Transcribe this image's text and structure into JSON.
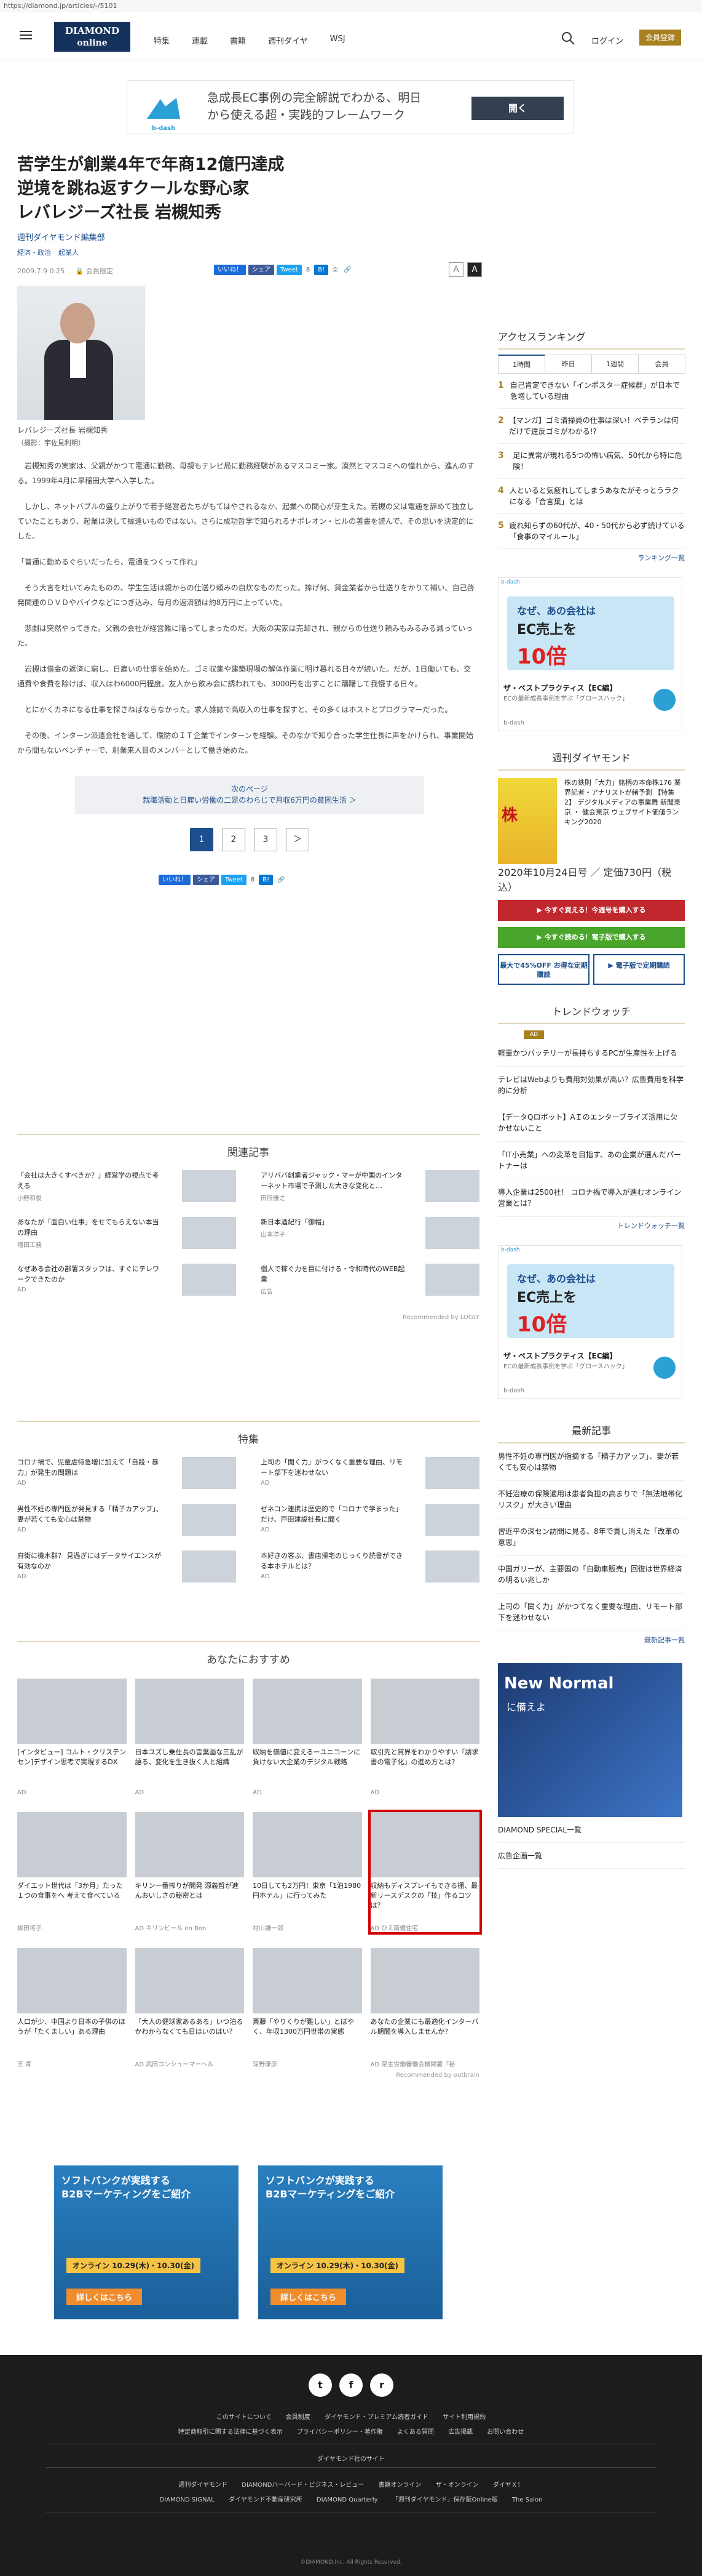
{
  "url": "https://diamond.jp/articles/-/5101",
  "header": {
    "logo_line1": "DIAMOND",
    "logo_line2": "online",
    "nav": [
      "特集",
      "連載",
      "書籍",
      "週刊ダイヤ",
      "WSJ"
    ],
    "login": "ログイン",
    "member": "会員登録"
  },
  "top_ad": {
    "brand": "b-dash",
    "text_line1": "急成長EC事例の完全解説でわかる、明日",
    "text_line2": "から使える超・実践的フレームワーク",
    "button": "開く"
  },
  "article": {
    "title_line1": "苦学生が創業4年で年商12億円達成",
    "title_line2": "逆境を跳ね返すクールな野心家",
    "title_line3": "レバレジーズ社長 岩槻知秀",
    "byline": "週刊ダイヤモンド編集部",
    "categories": [
      "経済・政治",
      "起業人"
    ],
    "date": "2009.7.9 0:25",
    "member_only": "会員限定",
    "share": {
      "like": "いいね！",
      "share": "シェア",
      "tweet": "Tweet",
      "count": "8",
      "b": "B!"
    },
    "font_small": "A",
    "font_large": "A",
    "photo_caption": "レバレジーズ社長 岩槻知秀",
    "photo_credit": "（撮影：宇佐見利明）",
    "paragraphs": [
      "岩槻知秀の実家は、父親がかつて電通に勤務、母親もテレビ局に勤務経験があるマスコミ一家。漠然とマスコミへの憧れから、進んのする。1999年4月に早稲田大学へ入学した。",
      "しかし、ネットバブルの盛り上がりで若手経営者たちがもてはやされるなか、起業への関心が芽生えた。若槻の父は電通を辞めて独立していたこともあり、起業は決して縁遠いものではない。さらに成功哲学で知られるナポレオン・ヒルの著書を読んで、その思いを決定的にした。",
      "「普通に勤めるぐらいだったら、電通をつくって作れ」",
      "そう大言を吐いてみたものの、学生生活は親からの仕送り頼みの自炊なものだった。捧げ何、貸金業者から仕送りをかりて補い、自己啓発関連のＤＶＤやバイクなどにつぎ込み、毎月の返済額は約8万円に上っていた。",
      "悲劇は突然やってきた。父親の会社が経営難に陥ってしまったのだ。大阪の実家は売却され、親からの仕送り頼みもみるみる減っていった。",
      "岩槻は借金の返済に窮し、日雇いの仕事を始めた。ゴミ収集や建築現場の解体作業に明け暮れる日々が続いた。だが、1日働いても、交通費や食費を除けば、収入はわ6000円程度。友人から飲み会に誘われても、3000円を出すことに躊躇して我慢する日々。",
      "とにかくカネになる仕事を探さねばならなかった。求人雑誌で高収入の仕事を探すと、その多くはホストとプログラマーだった。",
      "その後、インターン派遣会社を通して、環防のＩＴ企業でインターンを経験。そのなかで知り合った学生仕長に声をかけられ、事業開始から間もないベンチャーで、創業来人目のメンバーとして働き始めた。"
    ],
    "next_label": "次のページ",
    "next_title": "就職活動と日雇い労働の二足のわらじで月収6万円の貧困生活 ＞",
    "pages": [
      "1",
      "2",
      "3",
      "＞"
    ]
  },
  "related": {
    "heading": "関連記事",
    "items": [
      {
        "title": "「会社は大きくすべきか？」経営学の視点で考える",
        "source": "小野和俊"
      },
      {
        "title": "アリババ創業者ジャック・マーが中国のインターネット市場で予測した大きな変化と…",
        "source": "田所雅之"
      },
      {
        "title": "あなたが「面白い仕事」をせてもらえない本当の理由",
        "source": "増田工務"
      },
      {
        "title": "新日本酒紀行「御帽」",
        "source": "山本洋子"
      },
      {
        "title": "なぜある会社の部署スタッフは、すぐにテレワークできたのか",
        "source": "AD"
      },
      {
        "title": "個人で稼ぐ力を目に付ける・令和時代のWEB起業",
        "source": "広告"
      }
    ],
    "recommended_by": "Recommended by LOGLY"
  },
  "feature": {
    "heading": "特集",
    "items": [
      {
        "title": "コロナ禍で、児童虐待急増に加えて「自殺・暴力」が発生の問題は",
        "source": "AD"
      },
      {
        "title": "上司の「聞く力」がつくなく重要な理由、リモート部下を迷わせない",
        "source": "AD"
      },
      {
        "title": "男性不妊の専門医が発見する「精子カアップ」、妻が若くても安心は禁物",
        "source": "AD"
      },
      {
        "title": "ゼネコン連携は歴史的で「コロナで学まった」だけ、戸田建設社長に聞く",
        "source": "AD"
      },
      {
        "title": "府街に機木群？ 見過ぎにはデータサイエンスが有効なのか",
        "source": "AD"
      },
      {
        "title": "本好きの客ぶ、書店帰宅のじっくり読書ができる本ホテルとは？",
        "source": "AD"
      }
    ]
  },
  "recommend": {
    "heading": "あなたにおすすめ",
    "items": [
      {
        "title": "[インタビュー] コルト・クリステンセン]デザイン思考で実現するDX",
        "source": "AD"
      },
      {
        "title": "日本ユズし乗仕長の言葉画な三乱が語る、変化を生き抜く人と組織",
        "source": "AD"
      },
      {
        "title": "収納を価値に変えるーユニコーンに負けない大企業のデジタル戦略",
        "source": "AD"
      },
      {
        "title": "取引先と質界をわかりやすい「請求書の電子化」の進め方とは？",
        "source": "AD"
      },
      {
        "title": "ダイエット世代は「3か月」たった１つの食事をへ 考えて食べている",
        "source": "柳田将子"
      },
      {
        "title": "キリン一番搾りが開発 源義哲が進んおいしさの秘密とは",
        "source": "AD キリンビール on Bon"
      },
      {
        "title": "10日しても2万円！東京「1泊1980円ホテル」に行ってみた",
        "source": "村山謙一郎"
      },
      {
        "title": "収納もディスプレイもできる棚、最新リースデスクの「技」作るコツは？",
        "source": "AD ひえ南健住宅"
      },
      {
        "title": "人口が少、中国より日本の子供のほうが「たくましい」ある理由",
        "source": "王 青"
      },
      {
        "title": "「大人の健球家あるある」いつ泊るかわからなくても日はいのはい？",
        "source": "AD 武田コンシューマーヘル"
      },
      {
        "title": "斎藤「やりくりが難しい」とぼやく、年収1300万円世帯の実態",
        "source": "深野康彦"
      },
      {
        "title": "あなたの企業にも最適化インターパル期間を導入しませんか？",
        "source": "AD 菜主労働審働会機関署「秘"
      }
    ],
    "recommended_by": "Recommended by outbrain"
  },
  "bottom_ads": [
    {
      "line1": "ソフトバンクが実践する",
      "line2": "B2Bマーケティングをご紹介",
      "date": "オンライン 10.29(木)・10.30(金)",
      "cta": "詳しくはこちら"
    },
    {
      "line1": "ソフトバンクが実践する",
      "line2": "B2Bマーケティングをご紹介",
      "date": "オンライン 10.29(木)・10.30(金)",
      "cta": "詳しくはこちら"
    }
  ],
  "sidebar": {
    "ranking_heading": "アクセスランキング",
    "tabs": [
      "1時間",
      "昨日",
      "1週間",
      "会員"
    ],
    "ranking": [
      "自己肯定できない「インポスター症候群」が日本で急増している理由",
      "【マンガ】ゴミ清掃員の仕事は深い！ベテランは何だけで違反ゴミがわかる!?",
      "足に異常が現れる5つの怖い病気、50代から特に危険！",
      "人といると気疲れしてしまうあなたがそっとうラクになる「合言葉」とは",
      "疲れ知らずの60代が、40・50代から必ず続けている「食事のマイルール」"
    ],
    "ranking_more": "ランキング一覧",
    "ad": {
      "brand": "b-dash",
      "q1": "なぜ、あの会社は",
      "q2": "EC売上を",
      "q3": "10倍",
      "f1": "ザ・ベストプラクティス【EC編】",
      "f2": "ECの最新成長事例を学ぶ「グロースハック」",
      "f3": "b-dash"
    },
    "weekly_heading": "週刊ダイヤモンド",
    "weekly_cover": "株",
    "weekly_text": "株の鉄則「大力」銘柄の本命株176 業界記者・アナリストが緒予測 【特集2】 デジタルメディアの事業舞 新聞東京 ・ 健会東京 ウェブサイト価値ランキング2020",
    "weekly_date": "2020年10月24日号 ／ 定価730円（税込）",
    "buy_print": "▶ 今すぐ買える！今週号を購入する",
    "buy_digital": "▶ 今すぐ読める！電子版で購入する",
    "sub_print": "最大で45%OFF お得な定期購読",
    "sub_digital": "▶ 電子版で定期購読",
    "trend_heading": "トレンドウォッチ",
    "trend_tag": "AD",
    "trend": [
      "軽量かつバッテリーが長持ちするPCが生産性を上げる",
      "テレビはWebよりも費用対効果が高い？広告費用を科学的に分析",
      "【データQロボット】AＩのエンターブライズ活用に欠かせないこと",
      "「IT小売業」への変革を目指す、あの企業が選んだパートナーは",
      "導入企業は2500社！ コロナ禍で導入が進むオンライン営業とは？"
    ],
    "trend_more": "トレンドウォッチ一覧",
    "news_heading": "最新記事",
    "news": [
      "男性不妊の専門医が指摘する「精子力アップ」、妻が若くても安心は禁物",
      "不妊治療の保険適用は患者負担の高まりで「無法地帯化リスク」が大きい理由",
      "習近平の深セン訪問に見る、8年で貴し消えた「改革の意思」",
      "中国ガリーが、主要国の「自動車販売」回復は世界経済の明るい兆しか",
      "上司の「聞く力」がかつてなく重要な理由、リモート部下を迷わせない"
    ],
    "news_more": "最新記事一覧",
    "nn_line1": "New Normal",
    "nn_line2": "に備えよ",
    "special": "DIAMOND SPECIAL一覧",
    "adpage": "広告企画一覧"
  },
  "footer": {
    "social": [
      "t",
      "f",
      "r"
    ],
    "links1": [
      "このサイトについて",
      "会員制度",
      "ダイヤモンド・プレミアム読者ガイド",
      "サイト利用規約"
    ],
    "links2": [
      "特定商取引に関する法律に基づく表示",
      "プライバシーポリシー・著作権",
      "よくある質問",
      "広告掲載",
      "お問い合わせ"
    ],
    "group": "ダイヤモンド社のサイト",
    "links3": [
      "週刊ダイヤモンド",
      "DIAMONDハーバード・ビジネス・レビュー",
      "書籍オンライン",
      "ザ・オンライン",
      "ダイヤＸ！"
    ],
    "links4": [
      "DIAMOND SIGNAL",
      "ダイヤモンド不動産研究所",
      "DIAMOND Quarterly",
      "「週刊ダイヤモンド」保存版Online版",
      "The Salon"
    ],
    "copyright": "©DIAMOND,Inc. All Rights Reserved."
  }
}
